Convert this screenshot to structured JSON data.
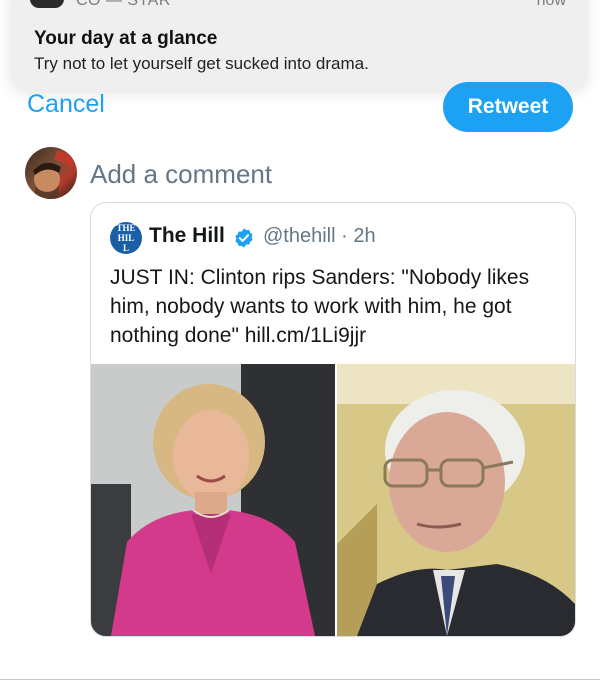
{
  "notification": {
    "app_name": "CO — STAR",
    "time": "now",
    "title": "Your day at a glance",
    "body": "Try not to let yourself get sucked into drama."
  },
  "header": {
    "cancel_label": "Cancel",
    "retweet_label": "Retweet"
  },
  "compose": {
    "placeholder": "Add a comment"
  },
  "quoted_tweet": {
    "logo_text": "THE HILL",
    "author_name": "The Hill",
    "verified": true,
    "handle_time": "@thehill · 2h",
    "text": "JUST IN: Clinton rips Sanders: \"Nobody likes him, nobody wants to work with him, he got nothing done\" hill.cm/1Li9jjr",
    "photos": [
      "hillary-clinton-photo",
      "bernie-sanders-photo"
    ]
  },
  "colors": {
    "accent": "#1da1f2",
    "secondary_text": "#657786",
    "card_border": "#d6dde3"
  }
}
